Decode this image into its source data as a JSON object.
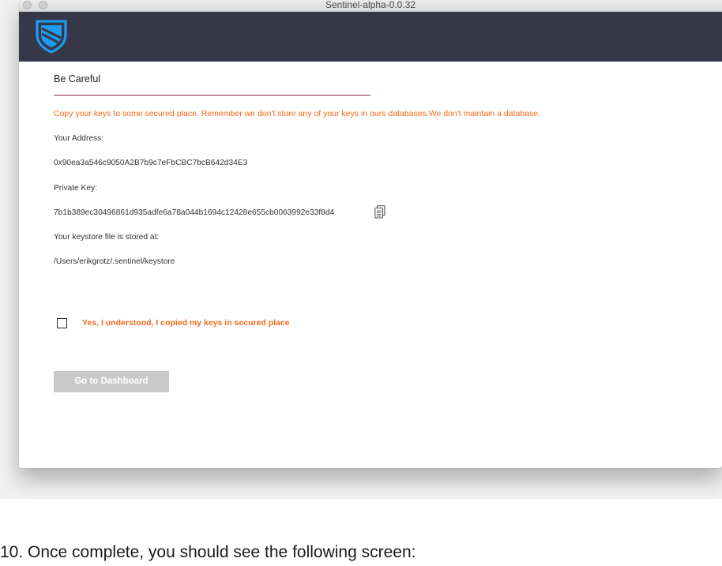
{
  "window": {
    "title": "Sentinel-alpha-0.0.32"
  },
  "header": {
    "logo_icon": "shield-logo-icon",
    "colors": {
      "bar": "#363749",
      "logo_blue": "#1e9cf0"
    }
  },
  "content": {
    "heading": "Be Careful",
    "warning": "Copy your keys to some secured place. Remember we don't store any of your keys in ours databases.We don't maintain a database.",
    "address_label": "Your Address:",
    "address_value": "0x90ea3a546c9050A2B7b9c7eFbCBC7bcB642d34E3",
    "private_key_label": "Private Key:",
    "private_key_value": "7b1b389ec30496861d935adfe6a78a044b1694c12428e655cb0063992e33f8d4",
    "copy_icon": "copy-icon",
    "keystore_label": "Your keystore file is stored at:",
    "keystore_value": "/Users/erikgrotz/.sentinel/keystore",
    "checkbox_label": "Yes, I understood, I copied my keys in secured place",
    "checkbox_checked": false,
    "dashboard_button": "Go to Dashboard",
    "colors": {
      "warning": "#f26a1b",
      "button_disabled": "#c9c9c9",
      "rule": "#8e2a45"
    }
  },
  "caption": "10. Once complete, you should see the following screen:"
}
